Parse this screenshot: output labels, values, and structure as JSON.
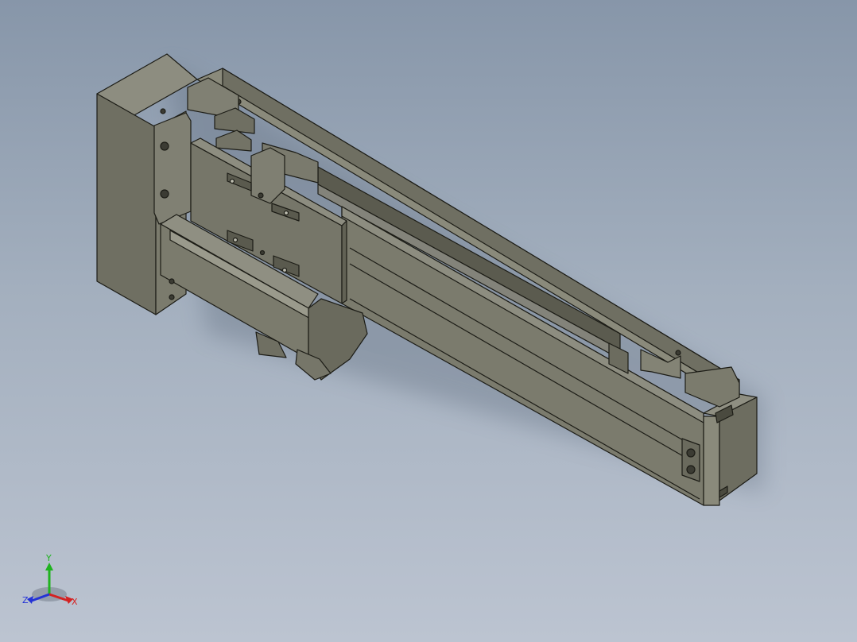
{
  "viewport": {
    "background_top": "#8796a9",
    "background_bottom": "#bcc4d1"
  },
  "model": {
    "body_color": "#7b7b6d",
    "light_face_color": "#8a8a7b",
    "dark_face_color": "#626255",
    "edge_color": "#1c1c16"
  },
  "triad": {
    "x_label": "X",
    "y_label": "Y",
    "z_label": "Z",
    "x_color": "#d42222",
    "y_color": "#1fb31f",
    "z_color": "#2433d6",
    "icon": "coordinate-triad-icon"
  }
}
